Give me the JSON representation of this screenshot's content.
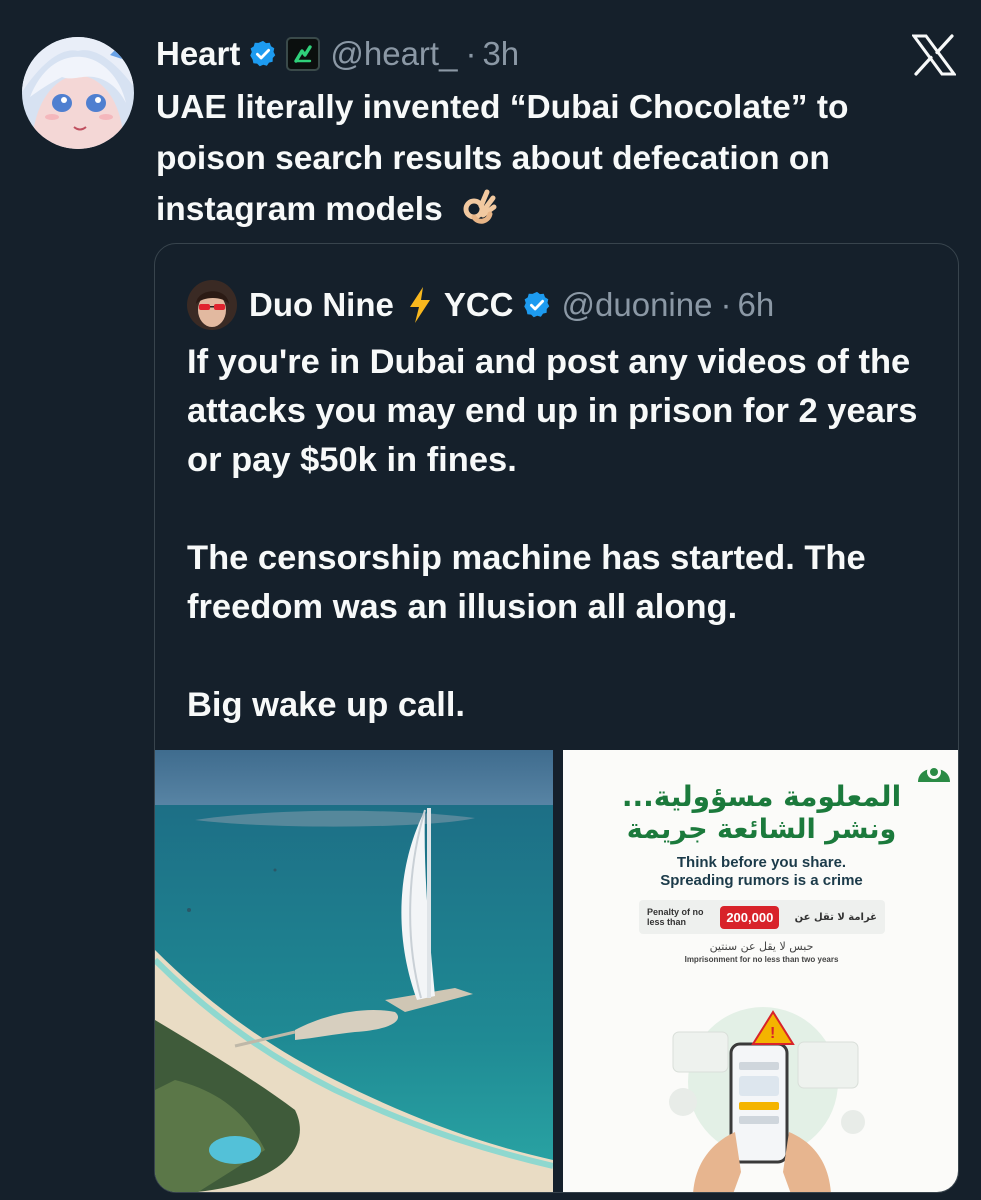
{
  "tweet": {
    "author_name": "Heart",
    "handle": "@heart_",
    "separator": "·",
    "time": "3h",
    "text": "UAE literally invented “Dubai Chocolate” to poison search results about defecation on instagram models",
    "emoji": "ok-hand-emoji"
  },
  "quoted_tweet": {
    "author_name": "Duo Nine",
    "name_suffix": "YCC",
    "handle": "@duonine",
    "separator": "·",
    "time": "6h",
    "paragraphs": [
      "If you're in Dubai and post any videos of the attacks you may end up in prison for 2 years or pay $50k in fines.",
      "The censorship machine has started. The freedom was an illusion all along.",
      "Big wake up call."
    ]
  },
  "media": {
    "image1": "aerial-photo-burj-al-arab-dubai-coast",
    "poster": {
      "arabic_line1": "المعلومة مسؤولية...",
      "arabic_line2": "ونشر الشائعة جريمة",
      "english_line1": "Think before you share.",
      "english_line2": "Spreading rumors is a crime",
      "penalty_en": "Penalty of no less than",
      "penalty_amount": "200,000",
      "penalty_ar": "غرامة لا تقل عن",
      "prison_ar": "حبس لا يقل عن سنتين",
      "prison_en": "Imprisonment for no less than two years"
    }
  },
  "colors": {
    "background": "#15202b",
    "text_primary": "#f7f9f9",
    "text_secondary": "#8b98a5",
    "verified_blue": "#1d9bf0",
    "border": "#38444d",
    "poster_green": "#1b7a3c",
    "poster_red": "#d8232a"
  }
}
